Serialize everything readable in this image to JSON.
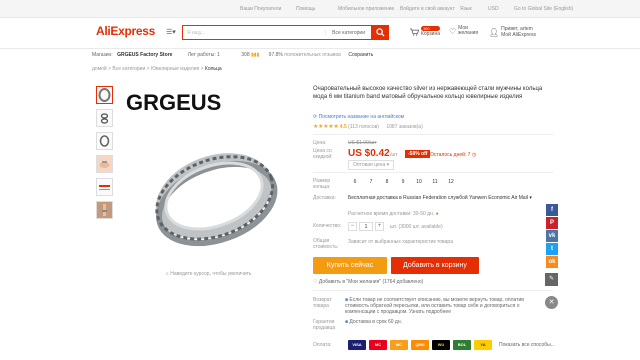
{
  "topbar": {
    "items": [
      "Ваши Покупатели",
      "Помощь",
      "Мобильное приложение",
      "Войдите в свой аккаунт",
      "Язык",
      "USD",
      "Go to Global Site (English)"
    ]
  },
  "header": {
    "logo_main": "AliExpress",
    "search_placeholder": "Я ищу...",
    "search_category": "Все категории",
    "cart_count": "100",
    "cart_label": "Корзина",
    "wishlist_label": "Мои желания",
    "user_greeting": "Привет, artem",
    "user_link": "Мой AliExpress"
  },
  "store": {
    "label": "Магазин:",
    "name": "GRGEUS Factory Store",
    "years": "Лет работы: 1",
    "score": "308",
    "feedback": "97.8%",
    "feedback_label": "положительных отзывов",
    "save": "Сохранить"
  },
  "breadcrumb": [
    "домой",
    "Все категории",
    "Ювелирные изделия",
    "Кольца"
  ],
  "product": {
    "brand": "GRGEUS",
    "title": "Очаровательный высокое качество silver из нержавеющей стали мужчины кольца мода 6 мм titanium band матовый обручальное кольцо ювелирные изделия",
    "translate_link": "Посмотреть название на английском",
    "rating": "4.5",
    "rating_count": "(113 голосов)",
    "orders": "1087 заказов(а)",
    "zoom_hint": "Наведите курсор, чтобы увеличить"
  },
  "pricing": {
    "price_label": "Цена:",
    "old_price": "US $1.00/шт",
    "discount_label": "Цена со скидкой:",
    "price": "US $0.42",
    "unit": "/шт",
    "discount": "-58% off",
    "time_left": "Осталось дней: 7",
    "bulk": "Оптовая цена"
  },
  "sizes": {
    "label": "Размер кольца:",
    "values": [
      "6",
      "7",
      "8",
      "9",
      "10",
      "11",
      "12"
    ]
  },
  "shipping": {
    "label": "Доставка:",
    "text": "Бесплатная доставка в Russian Federation службой Yanwen Economic Air Mail",
    "days": "Расчетное время доставки: 30-50 дн.",
    "qty_label": "Количество:",
    "qty": "1",
    "qty_available": "шт. (3000 шт. available)",
    "total_label": "Общая стоимость:",
    "total_text": "Зависит от выбранных характеристик товара"
  },
  "actions": {
    "buy_now": "Купить сейчас",
    "add_to_cart": "Добавить в корзину",
    "add_wishlist": "Добавить в \"Мои желания\" (1764 добавлено)"
  },
  "protection": [
    {
      "label": "Возврат товара",
      "text": "Если товар не соответствует описанию, вы можете вернуть товар, оплатив стоимость обратной пересылки, или оставить товар себе и договориться о компенсации с продавцом. Узнать подробнее"
    },
    {
      "label": "Гарантии продавца",
      "text": "Доставка в срок 60 дн."
    }
  ],
  "payment": {
    "label": "Оплата:",
    "methods": [
      "VISA",
      "MC",
      "MC",
      "QIWI",
      "WU",
      "BOL",
      "YA"
    ],
    "more": "Показать все способы..."
  },
  "colors": {
    "brand": "#e62e04",
    "buy_now": "#f39c12"
  }
}
